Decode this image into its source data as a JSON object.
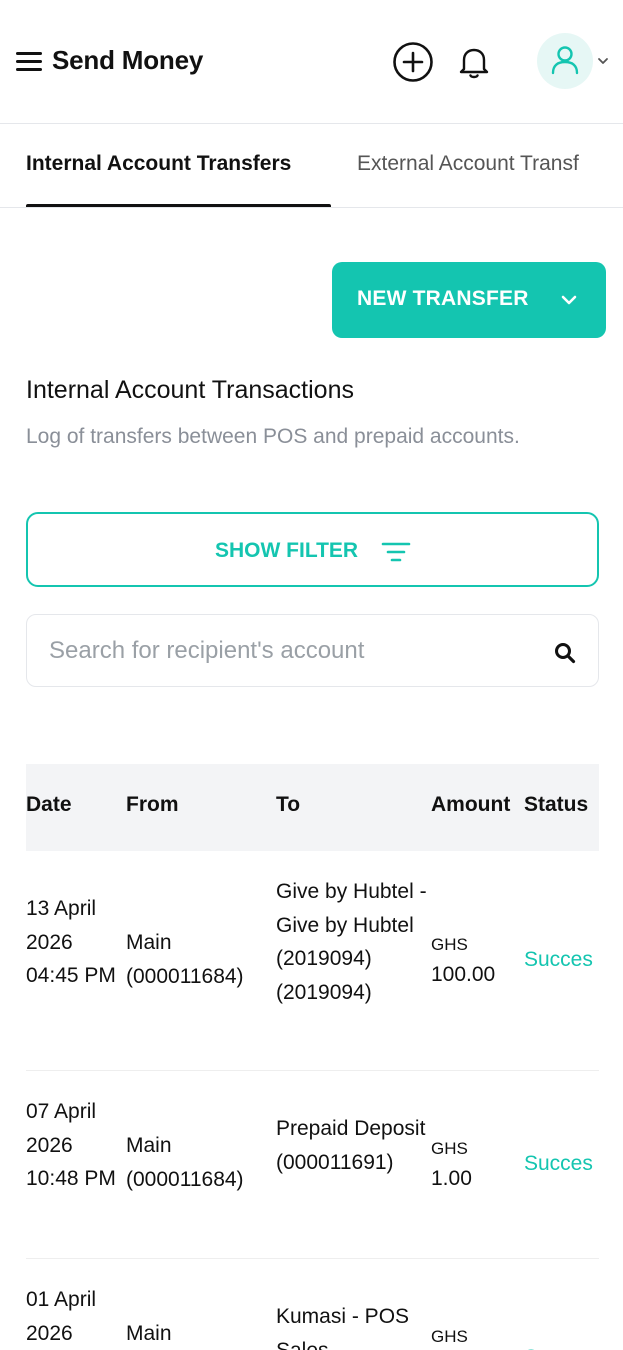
{
  "header": {
    "title": "Send Money"
  },
  "tabs": [
    {
      "label": "Internal Account Transfers",
      "active": true
    },
    {
      "label": "External Account Transf",
      "active": false
    }
  ],
  "actions": {
    "new_transfer_label": "NEW TRANSFER"
  },
  "section": {
    "title": "Internal Account Transactions",
    "description": "Log of transfers between POS and prepaid accounts."
  },
  "filter": {
    "label": "SHOW FILTER"
  },
  "search": {
    "placeholder": "Search for recipient's account"
  },
  "table": {
    "columns": [
      "Date",
      "From",
      "To",
      "Amount",
      "Status"
    ],
    "rows": [
      {
        "date": "13 April 2026 04:45 PM",
        "from": "Main (000011684)",
        "to": "Give by Hubtel - Give by Hubtel (2019094) (2019094)",
        "currency": "GHS",
        "amount": "100.00",
        "status": "Succes"
      },
      {
        "date": "07 April 2026 10:48 PM",
        "from": "Main (000011684)",
        "to": "Prepaid Deposit (000011691)",
        "currency": "GHS",
        "amount": "1.00",
        "status": "Succes"
      },
      {
        "date": "01 April 2026",
        "from": "Main",
        "to": "Kumasi - POS Sales",
        "currency": "GHS",
        "amount": "",
        "status": "Succes"
      }
    ]
  },
  "colors": {
    "accent": "#14c5b0",
    "text": "#111111",
    "muted": "#8a8f98",
    "table_header_bg": "#f3f4f6",
    "avatar_bg": "#e6f7f5"
  },
  "icons": {
    "menu": "hamburger-icon",
    "add": "plus-circle-icon",
    "notifications": "bell-icon",
    "profile": "user-icon",
    "profile_menu": "chevron-down-icon",
    "new_transfer": "chevron-down-icon",
    "filter": "filter-icon",
    "search": "search-icon"
  }
}
